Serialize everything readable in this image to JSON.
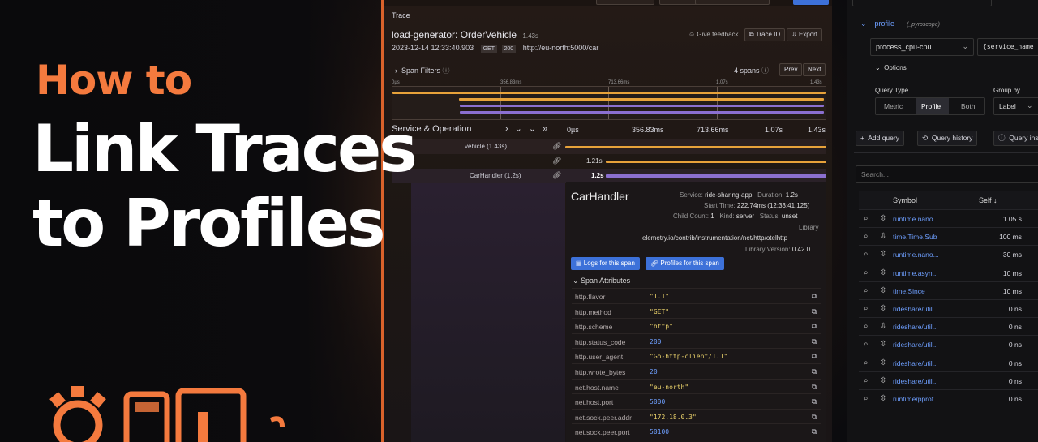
{
  "hero": {
    "kicker": "How to",
    "title_line1": "Link Traces",
    "title_line2": "to Profiles"
  },
  "trace": {
    "section_label": "Trace",
    "name": "load-generator: OrderVehicle",
    "duration": "1.43s",
    "timestamp": "2023-12-14 12:33:40.903",
    "method_badge": "GET",
    "status_badge": "200",
    "url": "http://eu-north:5000/car",
    "give_feedback": "Give feedback",
    "trace_id_btn": "Trace ID",
    "export_btn": "Export",
    "span_filters": "Span Filters",
    "span_count": "4 spans",
    "prev_btn": "Prev",
    "next_btn": "Next",
    "mini_ticks": [
      "0µs",
      "356.83ms",
      "713.66ms",
      "1.07s",
      "1.43s"
    ],
    "service_header": "Service & Operation",
    "timeline_ticks": [
      "0µs",
      "356.83ms",
      "713.66ms",
      "1.07s",
      "1.43s"
    ],
    "rows": [
      {
        "label": "vehicle (1.43s)",
        "dur": ""
      },
      {
        "label": "",
        "dur": "1.21s"
      },
      {
        "label": "CarHandler (1.2s)",
        "dur": "1.2s"
      }
    ],
    "detail": {
      "title": "CarHandler",
      "service_label": "Service:",
      "service": "ride-sharing-app",
      "duration_label": "Duration:",
      "duration": "1.2s",
      "start_label": "Start Time:",
      "start": "222.74ms (12:33:41.125)",
      "child_label": "Child Count:",
      "child": "1",
      "kind_label": "Kind:",
      "kind": "server",
      "status_label": "Status:",
      "status": "unset",
      "library_label": "Library",
      "library": "elemetry.io/contrib/instrumentation/net/http/otelhttp",
      "lib_version_label": "Library Version:",
      "lib_version": "0.42.0",
      "logs_btn": "Logs for this span",
      "profiles_btn": "Profiles for this span",
      "attrs_header": "Span Attributes"
    },
    "attributes": [
      {
        "k": "http.flavor",
        "v": "\"1.1\"",
        "color": "#e8d06a"
      },
      {
        "k": "http.method",
        "v": "\"GET\"",
        "color": "#e8d06a"
      },
      {
        "k": "http.scheme",
        "v": "\"http\"",
        "color": "#e8d06a"
      },
      {
        "k": "http.status_code",
        "v": "200",
        "color": "#6e9fff"
      },
      {
        "k": "http.user_agent",
        "v": "\"Go-http-client/1.1\"",
        "color": "#e8d06a"
      },
      {
        "k": "http.wrote_bytes",
        "v": "20",
        "color": "#6e9fff"
      },
      {
        "k": "net.host.name",
        "v": "\"eu-north\"",
        "color": "#e8d06a"
      },
      {
        "k": "net.host.port",
        "v": "5000",
        "color": "#6e9fff"
      },
      {
        "k": "net.sock.peer.addr",
        "v": "\"172.18.0.3\"",
        "color": "#e8d06a"
      },
      {
        "k": "net.sock.peer.port",
        "v": "50100",
        "color": "#6e9fff"
      }
    ]
  },
  "profile": {
    "query_name": "profile",
    "datasource": "(_pyroscope)",
    "profile_type": "process_cpu-cpu",
    "label_selector": "{service_name",
    "options": "Options",
    "query_type_label": "Query Type",
    "group_by_label": "Group by",
    "query_types": [
      "Metric",
      "Profile",
      "Both"
    ],
    "group_by_value": "Label",
    "add_query": "Add query",
    "query_history": "Query history",
    "query_inspector": "Query ins",
    "search_placeholder": "Search...",
    "col_symbol": "Symbol",
    "col_self": "Self",
    "rows": [
      {
        "sym": "runtime.nano...",
        "val": "1.05 s"
      },
      {
        "sym": "time.Time.Sub",
        "val": "100 ms"
      },
      {
        "sym": "runtime.nano...",
        "val": "30 ms"
      },
      {
        "sym": "runtime.asyn...",
        "val": "10 ms"
      },
      {
        "sym": "time.Since",
        "val": "10 ms"
      },
      {
        "sym": "rideshare/util...",
        "val": "0 ns"
      },
      {
        "sym": "rideshare/util...",
        "val": "0 ns"
      },
      {
        "sym": "rideshare/util...",
        "val": "0 ns"
      },
      {
        "sym": "rideshare/util...",
        "val": "0 ns"
      },
      {
        "sym": "rideshare/util...",
        "val": "0 ns"
      },
      {
        "sym": "runtime/pprof...",
        "val": "0 ns"
      }
    ]
  },
  "colors": {
    "accent": "#f47a3e",
    "span_orange": "#e7a23a",
    "span_purple": "#8b6fd0",
    "link_blue": "#6e9fff"
  }
}
